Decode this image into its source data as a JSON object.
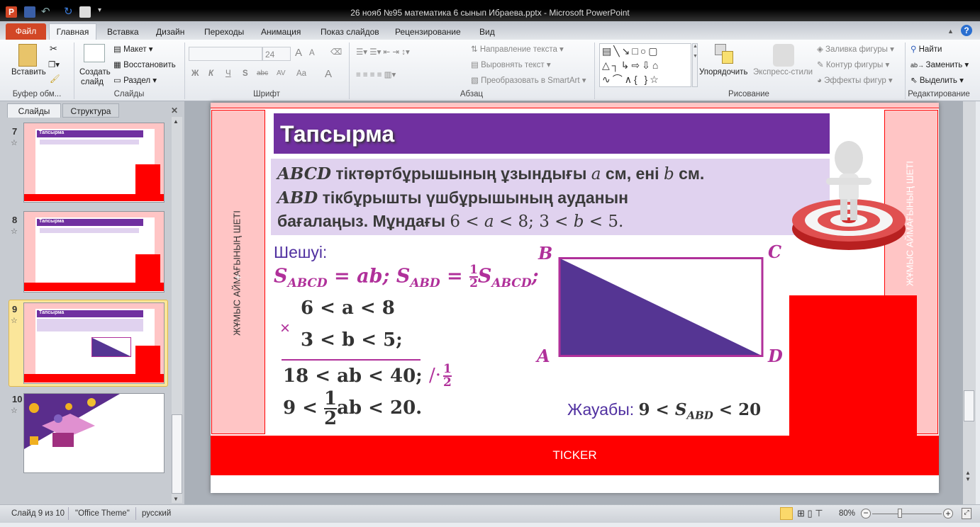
{
  "window": {
    "title": "26 нояб №95 математика 6 сынып Ибраева.pptx  -  Microsoft PowerPoint"
  },
  "tabs": {
    "file": "Файл",
    "items": [
      "Главная",
      "Вставка",
      "Дизайн",
      "Переходы",
      "Анимация",
      "Показ слайдов",
      "Рецензирование",
      "Вид"
    ]
  },
  "ribbon": {
    "clipboard": {
      "paste": "Вставить",
      "label": "Буфер обм..."
    },
    "slides": {
      "new_slide_1": "Создать",
      "new_slide_2": "слайд",
      "layout": "Макет",
      "reset": "Восстановить",
      "section": "Раздел",
      "label": "Слайды"
    },
    "font": {
      "font_name": "",
      "font_size": "24",
      "bold": "Ж",
      "italic": "К",
      "underline": "Ч",
      "shadow": "S",
      "strike": "abc",
      "spacing": "AV",
      "case": "Aa",
      "color": "A",
      "grow": "A",
      "shrink": "A",
      "label": "Шрифт"
    },
    "paragraph": {
      "text_direction": "Направление текста",
      "align_text": "Выровнять текст",
      "smartart": "Преобразовать в SmartArt",
      "label": "Абзац"
    },
    "drawing": {
      "arrange": "Упорядочить",
      "quick_styles": "Экспресс-стили",
      "fill": "Заливка фигуры",
      "outline": "Контур фигуры",
      "effects": "Эффекты фигур",
      "label": "Рисование"
    },
    "editing": {
      "find": "Найти",
      "replace": "Заменить",
      "select": "Выделить",
      "label": "Редактирование"
    }
  },
  "panel": {
    "tab_slides": "Слайды",
    "tab_outline": "Структура",
    "close": "✕",
    "thumbs": [
      {
        "num": "7",
        "title": "Тапсырма"
      },
      {
        "num": "8",
        "title": "Тапсырма"
      },
      {
        "num": "9",
        "title": "Тапсырма"
      },
      {
        "num": "10",
        "title": ""
      }
    ]
  },
  "slide": {
    "side_text": "ЖҰМЫС АЙМАҒЫНЫҢ ШЕТІ",
    "title": "Тапсырма",
    "problem": {
      "l1a": "ABCD",
      "l1b": " тіктөртбұрышының ұзындығы ",
      "l1c": "a",
      "l1d": " см, ені ",
      "l1e": "b",
      "l1f": " см.",
      "l2a": "ABD",
      "l2b": " тікбұрышты үшбұрышының ауданын",
      "l3a": "бағалаңыз. Мұндағы ",
      "l3b": "6 < ",
      "l3c": "a",
      "l3d": " < 8;  3 < ",
      "l3e": "b",
      "l3f": " < 5."
    },
    "solution_label": "Шешуі:",
    "formula": {
      "s": "S",
      "abcd": "ABCD",
      "eq_ab": " = ab; ",
      "abd": "ABD",
      "eq": " = ",
      "num": "1",
      "den": "2",
      "semi": ";"
    },
    "ineq1": "6 < a < 8",
    "times": "×",
    "ineq2": "3 < b < 5;",
    "ineq3": "18 < ab < 40;",
    "mult": "/·",
    "half_num": "1",
    "half_den": "2",
    "ineq4a": "9 < ",
    "ineq4b": "ab < 20.",
    "vertices": {
      "A": "A",
      "B": "B",
      "C": "C",
      "D": "D"
    },
    "answer_label": "Жауабы: ",
    "answer_a": "9 < ",
    "answer_s": "S",
    "answer_sub": "ABD",
    "answer_b": " < 20",
    "ticker": "TICKER"
  },
  "status": {
    "slide": "Слайд 9 из 10",
    "theme": "\"Office Theme\"",
    "lang": "русский",
    "zoom": "80%",
    "zoom_level": 0.4
  },
  "colors": {
    "purple": "#7030a0",
    "lavender": "#e0d2ef",
    "magenta": "#b0309a",
    "red": "#ff0000",
    "pink": "#ffc5c5",
    "triangle": "#553593",
    "file_tab": "#d24726"
  }
}
